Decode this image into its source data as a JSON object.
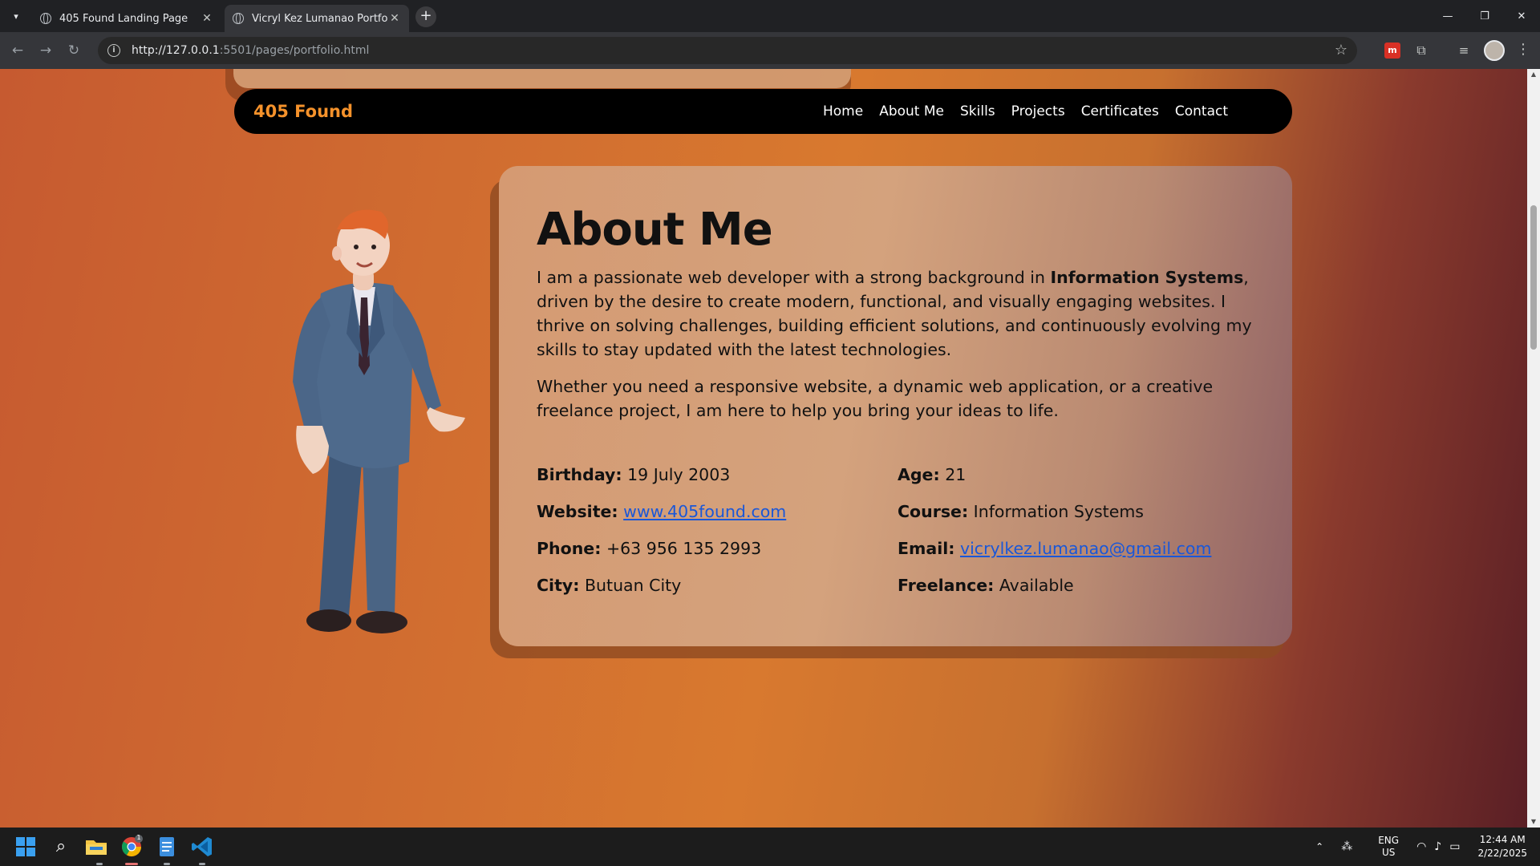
{
  "browser": {
    "tabs": [
      {
        "title": "405 Found Landing Page",
        "active": false
      },
      {
        "title": "Vicryl Kez Lumanao Portfolio",
        "active": true
      }
    ],
    "url_host": "http://127.0.0.1",
    "url_rest": ":5501/pages/portfolio.html"
  },
  "navbar": {
    "brand": "405 Found",
    "links": [
      "Home",
      "About Me",
      "Skills",
      "Projects",
      "Certificates",
      "Contact"
    ],
    "brand_color": "#f5922b"
  },
  "about": {
    "title": "About Me",
    "para1_before": "I am a passionate web developer with a strong background in ",
    "para1_bold": "Information Systems",
    "para1_after": ", driven by the desire to create modern, functional, and visually engaging websites. I thrive on solving challenges, building efficient solutions, and continuously evolving my skills to stay updated with the latest technologies.",
    "para2": "Whether you need a responsive website, a dynamic web application, or a creative freelance project, I am here to help you bring your ideas to life.",
    "details": {
      "birthday": {
        "label": "Birthday:",
        "value": "19 July 2003"
      },
      "age": {
        "label": "Age:",
        "value": "21"
      },
      "website": {
        "label": "Website:",
        "value": "www.405found.com"
      },
      "course": {
        "label": "Course:",
        "value": "Information Systems"
      },
      "phone": {
        "label": "Phone:",
        "value": "+63 956 135 2993"
      },
      "email": {
        "label": "Email:",
        "value": "vicrylkez.lumanao@gmail.com"
      },
      "city": {
        "label": "City:",
        "value": "Butuan City"
      },
      "freelance": {
        "label": "Freelance:",
        "value": "Available"
      }
    }
  },
  "taskbar": {
    "lang_top": "ENG",
    "lang_bottom": "US",
    "time": "12:44 AM",
    "date": "2/22/2025",
    "chrome_badge": "1"
  },
  "icons": [
    "tab-search-icon",
    "globe-icon",
    "close-icon",
    "plus-icon",
    "back-icon",
    "forward-icon",
    "reload-icon",
    "info-icon",
    "star-icon",
    "puzzle-icon",
    "media-icon",
    "kebab-icon",
    "windows-icon",
    "search-icon",
    "folder-icon",
    "chrome-icon",
    "notepad-icon",
    "vscode-icon",
    "wifi-icon",
    "volume-icon",
    "battery-icon"
  ]
}
